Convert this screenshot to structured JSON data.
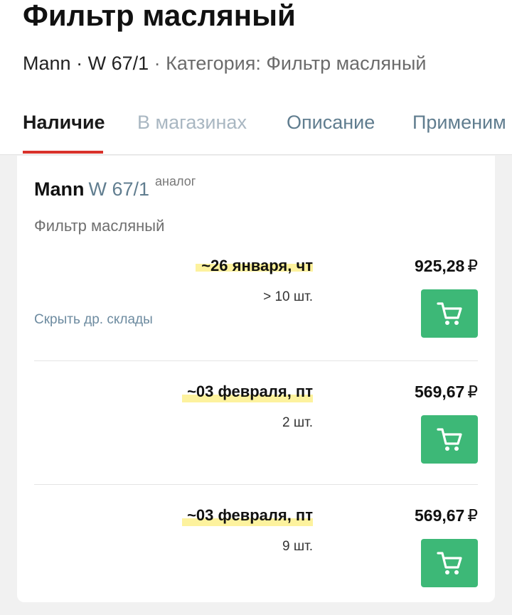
{
  "header": {
    "title": "Фильтр масляный",
    "brand": "Mann",
    "dot": "·",
    "article": "W 67/1",
    "category": "Категория: Фильтр масляный"
  },
  "tabs": [
    {
      "label": "Наличие",
      "state": "active"
    },
    {
      "label": "В магазинах",
      "state": "disabled"
    },
    {
      "label": "Описание",
      "state": "normal"
    },
    {
      "label": "Применим",
      "state": "normal"
    }
  ],
  "product": {
    "brand": "Mann",
    "article": "W 67/1",
    "tag": "аналог",
    "description": "Фильтр масляный"
  },
  "offers": [
    {
      "date": "~26 января, чт",
      "qty": "> 10 шт.",
      "price": "925,28",
      "currency": "₽",
      "cart_icon": "cart-icon"
    },
    {
      "date": "~03 февраля, пт",
      "qty": "2 шт.",
      "price": "569,67",
      "currency": "₽",
      "cart_icon": "cart-icon"
    },
    {
      "date": "~03 февраля, пт",
      "qty": "9 шт.",
      "price": "569,67",
      "currency": "₽",
      "cart_icon": "cart-icon"
    }
  ],
  "hide_warehouses_link": "Скрыть др. склады",
  "colors": {
    "accent_red": "#d9322b",
    "cart_green": "#3db877",
    "date_highlight": "#fdf29e",
    "link_blue": "#607d8f"
  }
}
